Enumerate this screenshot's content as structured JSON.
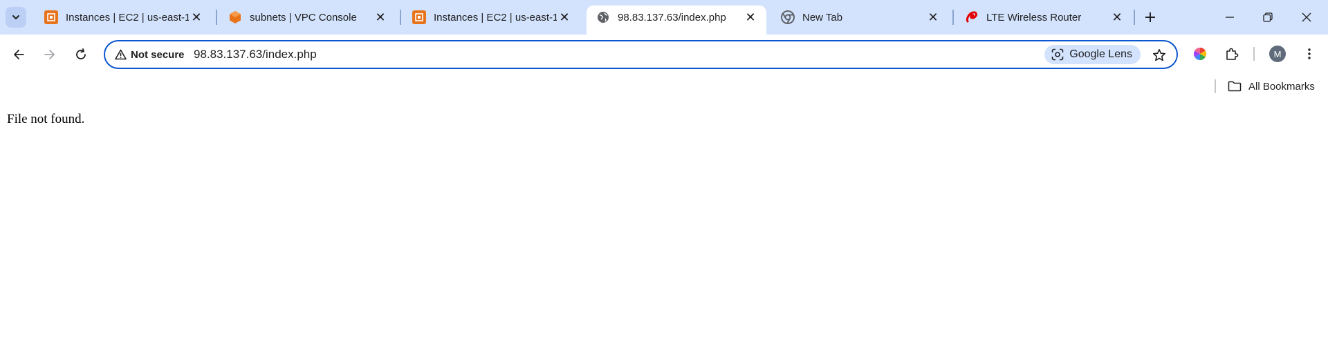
{
  "tabs": [
    {
      "title": "Instances | EC2 | us-east-1",
      "icon": "aws-ec2-icon",
      "active": false
    },
    {
      "title": "subnets | VPC Console",
      "icon": "aws-vpc-icon",
      "active": false
    },
    {
      "title": "Instances | EC2 | us-east-1",
      "icon": "aws-ec2-icon",
      "active": false
    },
    {
      "title": "98.83.137.63/index.php",
      "icon": "globe-icon",
      "active": true
    },
    {
      "title": "New Tab",
      "icon": "chrome-icon",
      "active": false
    },
    {
      "title": "LTE Wireless Router",
      "icon": "airtel-icon",
      "active": false
    }
  ],
  "omnibox": {
    "security_label": "Not secure",
    "url": "98.83.137.63/index.php",
    "lens_label": "Google Lens"
  },
  "profile": {
    "initial": "M"
  },
  "bookmarks": {
    "all_label": "All Bookmarks"
  },
  "page": {
    "message": "File not found."
  },
  "colors": {
    "tabstrip": "#d3e3fd",
    "focus_ring": "#0b57d0",
    "aws_orange": "#e8731a",
    "airtel_red": "#e40000"
  }
}
